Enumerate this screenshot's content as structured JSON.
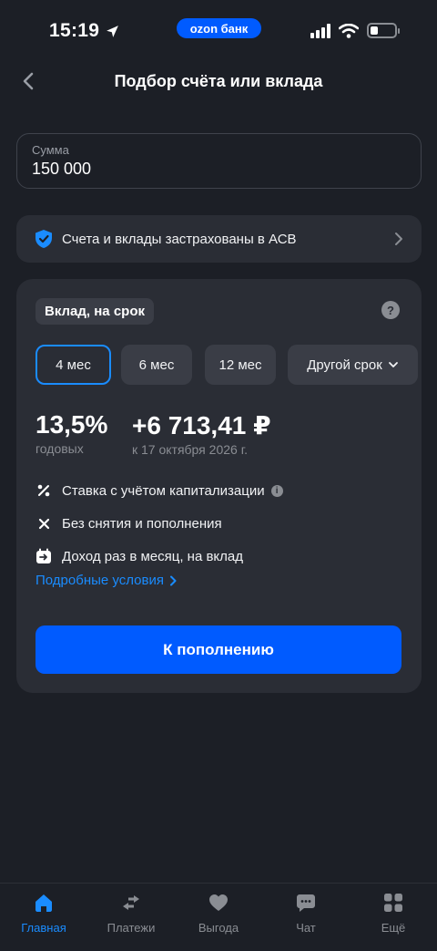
{
  "status_bar": {
    "time": "15:19",
    "brand": "ozon банк"
  },
  "header": {
    "title": "Подбор счёта или вклада",
    "back_icon": "chevron-left-icon"
  },
  "amount": {
    "label": "Сумма",
    "value": "150 000"
  },
  "insurance": {
    "text": "Счета и вклады застрахованы в АСВ",
    "icon": "shield-check-icon"
  },
  "deposit": {
    "tag": "Вклад, на срок",
    "help": "?",
    "terms": [
      {
        "label": "4 мес",
        "selected": true
      },
      {
        "label": "6 мес",
        "selected": false
      },
      {
        "label": "12 мес",
        "selected": false
      },
      {
        "label": "Другой срок",
        "selected": false
      }
    ],
    "rate": "13,5%",
    "rate_caption": "годовых",
    "income": "+6 713,41 ₽",
    "income_caption": "к 17 октября 2026 г.",
    "features": [
      {
        "icon": "percent-icon",
        "text": "Ставка с учётом капитализации"
      },
      {
        "icon": "close-icon",
        "text": "Без снятия и пополнения"
      },
      {
        "icon": "calendar-icon",
        "text": "Доход раз в месяц, на вклад"
      }
    ],
    "details_link": "Подробные условия",
    "cta": "К пополнению"
  },
  "tab_bar": {
    "items": [
      {
        "label": "Главная",
        "icon": "home-icon",
        "active": true
      },
      {
        "label": "Платежи",
        "icon": "transfer-icon",
        "active": false
      },
      {
        "label": "Выгода",
        "icon": "heart-icon",
        "active": false
      },
      {
        "label": "Чат",
        "icon": "chat-icon",
        "active": false
      },
      {
        "label": "Ещё",
        "icon": "grid-icon",
        "active": false
      }
    ]
  },
  "colors": {
    "background": "#1c1f26",
    "card": "#2a2d35",
    "accent": "#005bff",
    "link": "#1a8cff",
    "muted": "#8a8d93"
  }
}
